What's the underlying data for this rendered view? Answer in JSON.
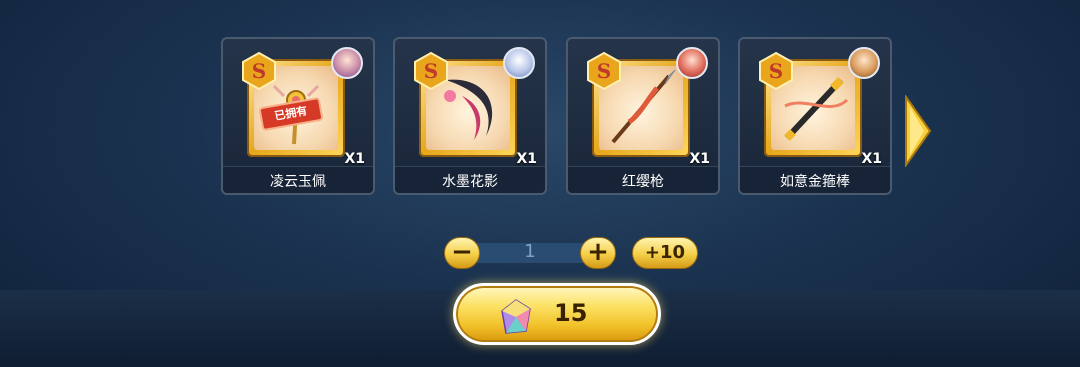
{
  "colors": {
    "accent_gold": "#f4cf47",
    "card_bg": "#1a2638",
    "background": "#1b3350"
  },
  "items": [
    {
      "name": "凌云玉佩",
      "quantity": "X1",
      "owned": true,
      "owned_label": "已拥有",
      "badge_icon": "s-rank-icon",
      "avatar_icon": "hero-avatar-icon"
    },
    {
      "name": "水墨花影",
      "quantity": "X1",
      "owned": false,
      "badge_icon": "s-rank-icon",
      "avatar_icon": "hero-avatar-icon"
    },
    {
      "name": "红缨枪",
      "quantity": "X1",
      "owned": false,
      "badge_icon": "s-rank-icon",
      "avatar_icon": "hero-avatar-icon"
    },
    {
      "name": "如意金箍棒",
      "quantity": "X1",
      "owned": false,
      "badge_icon": "s-rank-icon",
      "avatar_icon": "hero-avatar-icon"
    }
  ],
  "quantity_selector": {
    "decrement_label": "−",
    "value": "1",
    "increment_label": "+",
    "plus_ten_label": "+10"
  },
  "purchase": {
    "price": "15",
    "currency_icon": "crystal-gem-icon"
  }
}
